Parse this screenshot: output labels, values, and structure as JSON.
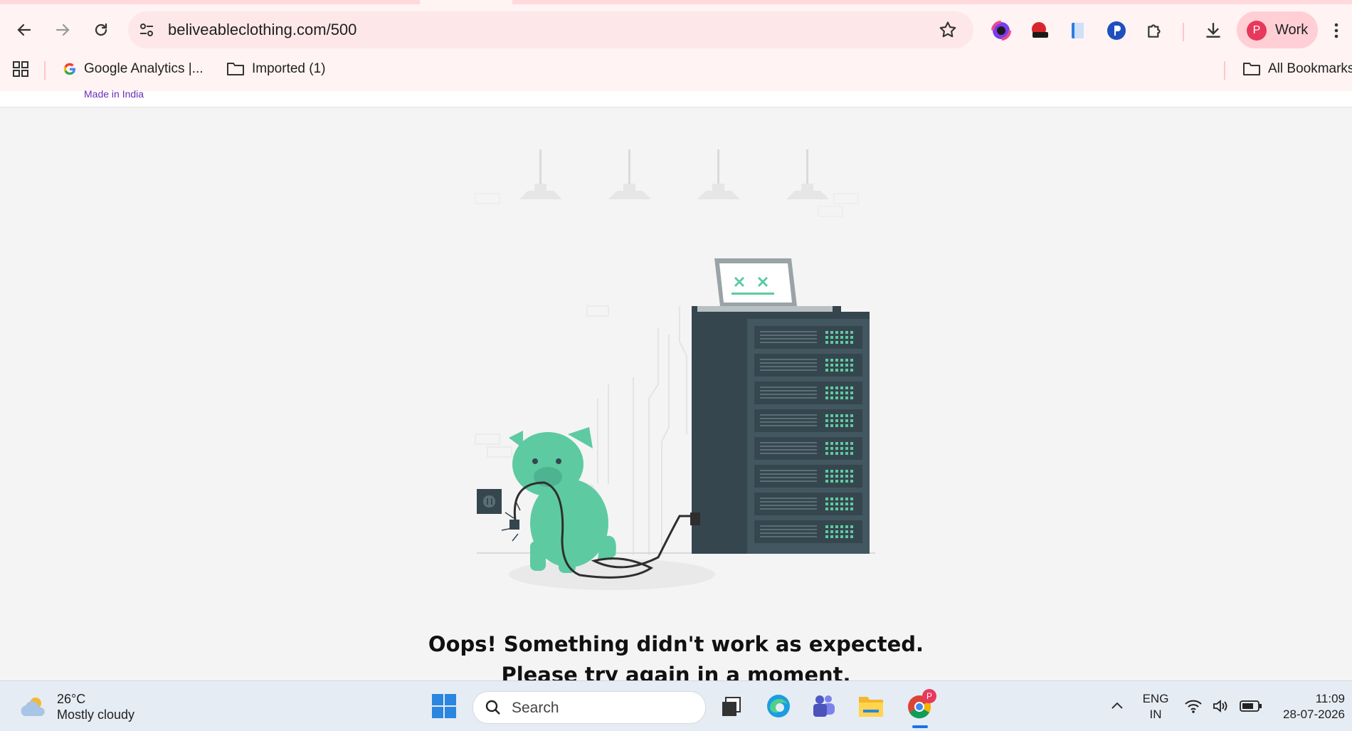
{
  "browser": {
    "url": "beliveableclothing.com/500",
    "profile": {
      "initial": "P",
      "label": "Work"
    },
    "bookmarks": [
      {
        "label": "Google Analytics  |..."
      },
      {
        "label": "Imported (1)"
      }
    ],
    "all_bookmarks": "All Bookmarks"
  },
  "page": {
    "header_tag": "Made in India",
    "error_line1": "Oops! Something didn't work as expected.",
    "error_line2": "Please try again in a moment."
  },
  "taskbar": {
    "weather": {
      "temp": "26°C",
      "desc": "Mostly cloudy"
    },
    "search_placeholder": "Search",
    "lang": {
      "line1": "ENG",
      "line2": "IN"
    },
    "time": "11:09",
    "date": "28-07-2026",
    "chrome_badge": "P"
  },
  "colors": {
    "accent_green": "#5dcaa2",
    "server_dark": "#36464e",
    "chrome_bg": "#fff3f3",
    "profile_red": "#e8385c"
  }
}
